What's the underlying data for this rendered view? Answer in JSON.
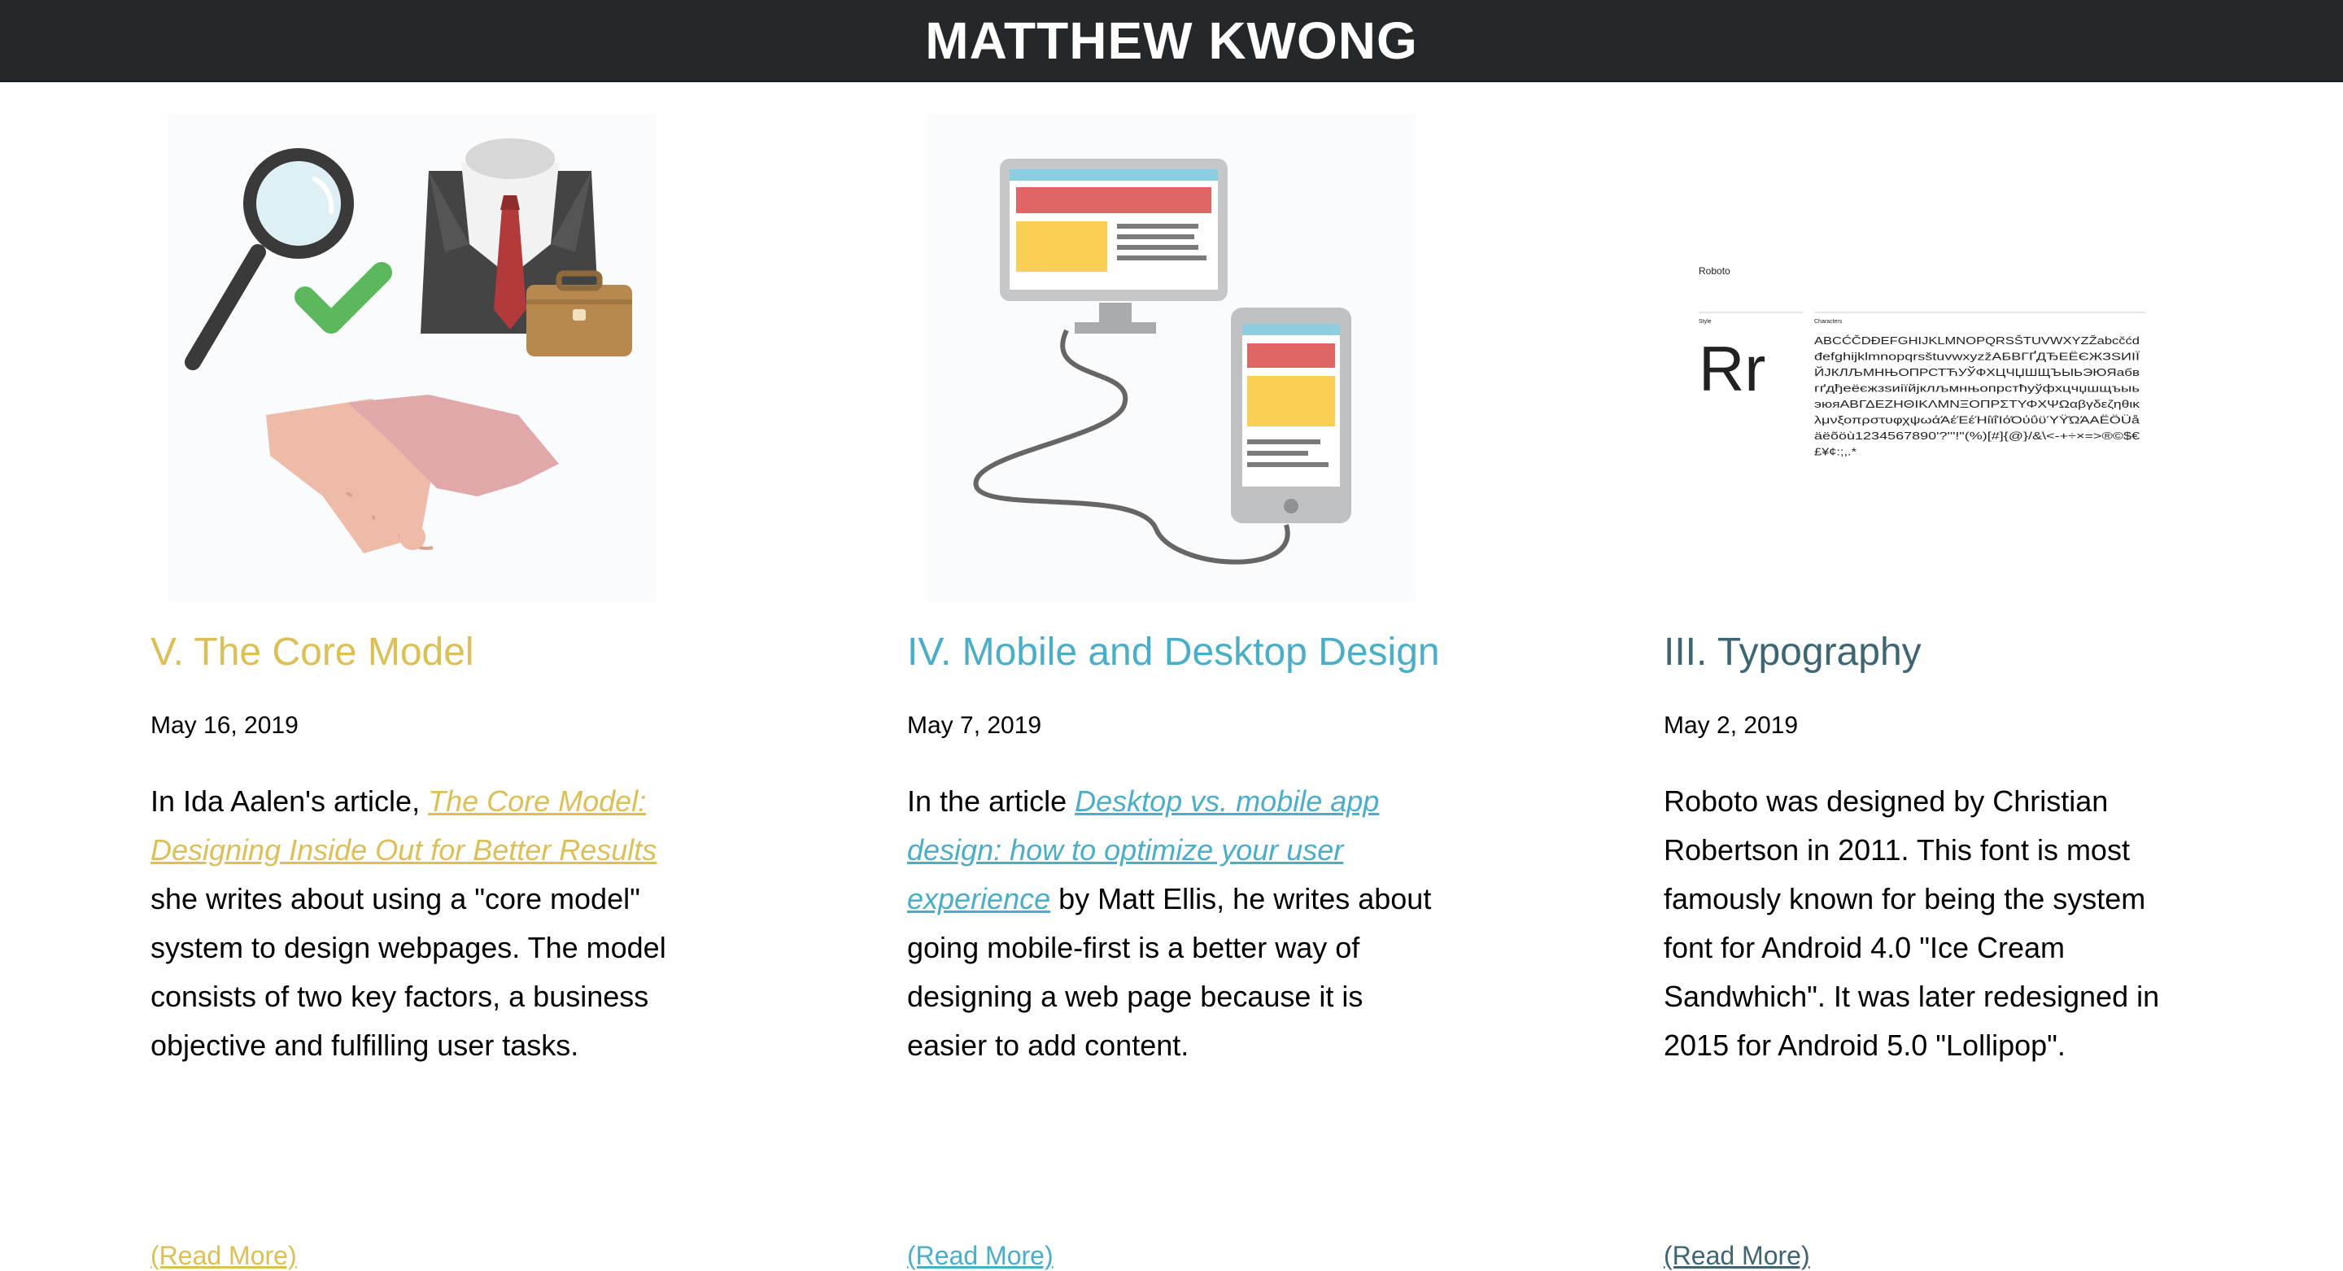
{
  "site": {
    "title": "MATTHEW KWONG"
  },
  "posts": [
    {
      "title": "V. The Core Model",
      "date": "May 16, 2019",
      "body_before": "In Ida Aalen's article, ",
      "link": "The Core Model: Designing Inside Out for Better Results",
      "body_after": " she writes about using a \"core model\" system to design webpages. The model consists of two key factors, a business objective and fulfilling user tasks.",
      "read_more": "(Read More)",
      "accent": "#dcbf55"
    },
    {
      "title": "IV. Mobile and Desktop Design",
      "date": "May 7, 2019",
      "body_before": "In the article ",
      "link": "Desktop vs. mobile app design: how to optimize your user experience",
      "body_after": " by Matt Ellis, he writes about going mobile-first is a better way of designing a web page because it is easier to add content.",
      "read_more": "(Read More)",
      "accent": "#4aaec9"
    },
    {
      "title": "III. Typography",
      "date": "May 2, 2019",
      "body": "Roboto was designed by Christian Robertson in 2011. This font is most famously known for being the system font for Android 4.0 \"Ice Cream Sandwhich\". It was later redesigned in 2015 for Android 5.0 \"Lollipop\".",
      "read_more": "(Read More)",
      "accent": "#3e6672",
      "specimen": {
        "font_name": "Roboto",
        "style_label": "Style",
        "characters_label": "Characters",
        "sample": "Rr",
        "char_lines": [
          "ABCĆČDĐEFGHIJKLMNOPQRSŠTUVWXYZŽabcčćd",
          "đefghijklmnopqrsštuvwxyzžАБВГҐДЂЕЁЄЖЗЅИІЇ",
          "ЙЈКЛЉМНЊОПРСТЋУЎФХЦЧЏШЩЪЫЬЭЮЯабв",
          "гґдђеёєжзѕиіїйјклљмнњопрстћуўфхцчџшщъыь",
          "эюяАВΓΔΕΖΗΘΙΚΛΜΝΞΟΠΡΣΤΥΦΧΨΩαβγδεζηθικ",
          "λμνξοπρστυφχψωάΆέΈέΉίϊΐΊόΌύΰϋΎΫΏΆΑËÖÜå",
          "äëõöù1234567890'?'\"!\"(%)[#]{@}/&\\<-+÷×=>®©$€",
          "£¥¢:;,.*"
        ]
      }
    }
  ]
}
